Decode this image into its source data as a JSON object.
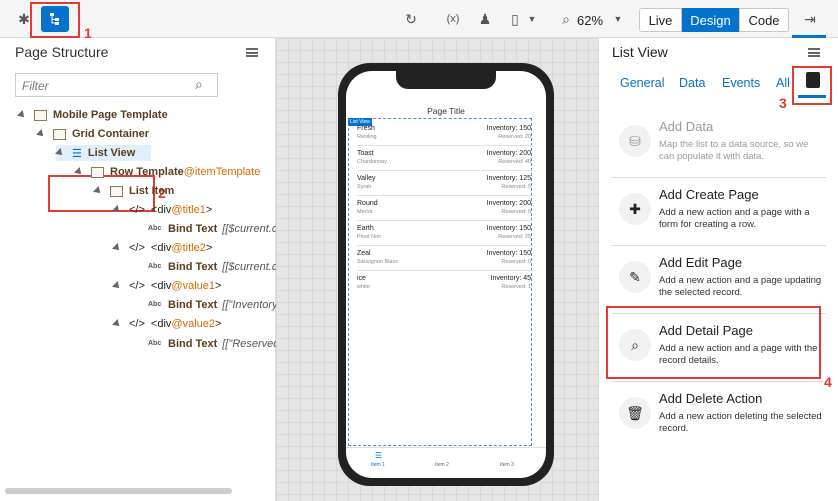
{
  "toolbar": {
    "live": "Live",
    "design": "Design",
    "code": "Code",
    "zoom": "62%",
    "icons": [
      "puzzle-icon",
      "structure-icon",
      "refresh-icon",
      "code-scope-icon",
      "user-role-icon",
      "phone-icon",
      "zoom-icon",
      "panel-toggle-icon"
    ]
  },
  "annotations": {
    "n1": "1",
    "n2": "2",
    "n3": "3",
    "n4": "4"
  },
  "left": {
    "title": "Page Structure",
    "filter_placeholder": "Filter",
    "tree": [
      {
        "label": "Mobile Page Template",
        "extra": ""
      },
      {
        "label": "Grid Container",
        "extra": ""
      },
      {
        "label": "List View",
        "extra": ""
      },
      {
        "label": "Row Template",
        "extra": "@itemTemplate"
      },
      {
        "label": "List Item",
        "extra": ""
      },
      {
        "label": "<div",
        "extra": "@title1",
        "tail": ">"
      },
      {
        "label": "Bind Text",
        "extra": "[[$current.da"
      },
      {
        "label": "<div",
        "extra": "@title2",
        "tail": ">"
      },
      {
        "label": "Bind Text",
        "extra": "[[$current.da"
      },
      {
        "label": "<div",
        "extra": "@value1",
        "tail": ">"
      },
      {
        "label": "Bind Text",
        "extra": "[[\"Inventory:"
      },
      {
        "label": "<div",
        "extra": "@value2",
        "tail": ">"
      },
      {
        "label": "Bind Text",
        "extra": "[[\"Reserved:"
      }
    ],
    "code_marker": "</>",
    "abc": "Abc"
  },
  "phone": {
    "page_title": "Page Title",
    "list_tag": "List View",
    "rows": [
      {
        "title": "Fresh",
        "sub": "Riesling",
        "inv": "Inventory: 150",
        "res": "Reserved: 20"
      },
      {
        "title": "Toast",
        "sub": "Chardonnay",
        "inv": "Inventory: 200",
        "res": "Reserved: 40"
      },
      {
        "title": "Valley",
        "sub": "Syrah",
        "inv": "Inventory: 125",
        "res": "Reserved: 5"
      },
      {
        "title": "Round",
        "sub": "Merlot",
        "inv": "Inventory: 200",
        "res": "Reserved: 0"
      },
      {
        "title": "Earth",
        "sub": "Pinot Noir",
        "inv": "Inventory: 150",
        "res": "Reserved: 25"
      },
      {
        "title": "Zeal",
        "sub": "Sauvignon Blanc",
        "inv": "Inventory: 150",
        "res": "Reserved: 0"
      },
      {
        "title": "ice",
        "sub": "white",
        "inv": "Inventory: 45",
        "res": "Reserved: 1"
      }
    ],
    "tabs": [
      "Item 1",
      "Item 2",
      "Item 3"
    ]
  },
  "right": {
    "title": "List View",
    "tabs": [
      "General",
      "Data",
      "Events",
      "All"
    ],
    "cards": [
      {
        "title": "Add Data",
        "desc": "Map the list to a data source, so we can populate it with data."
      },
      {
        "title": "Add Create Page",
        "desc": "Add a new action and a page with a form for creating a row."
      },
      {
        "title": "Add Edit Page",
        "desc": "Add a new action and a page updating the selected record."
      },
      {
        "title": "Add Detail Page",
        "desc": "Add a new action and a page with the record details."
      },
      {
        "title": "Add Delete Action",
        "desc": "Add a new action deleting the selected record."
      }
    ]
  }
}
